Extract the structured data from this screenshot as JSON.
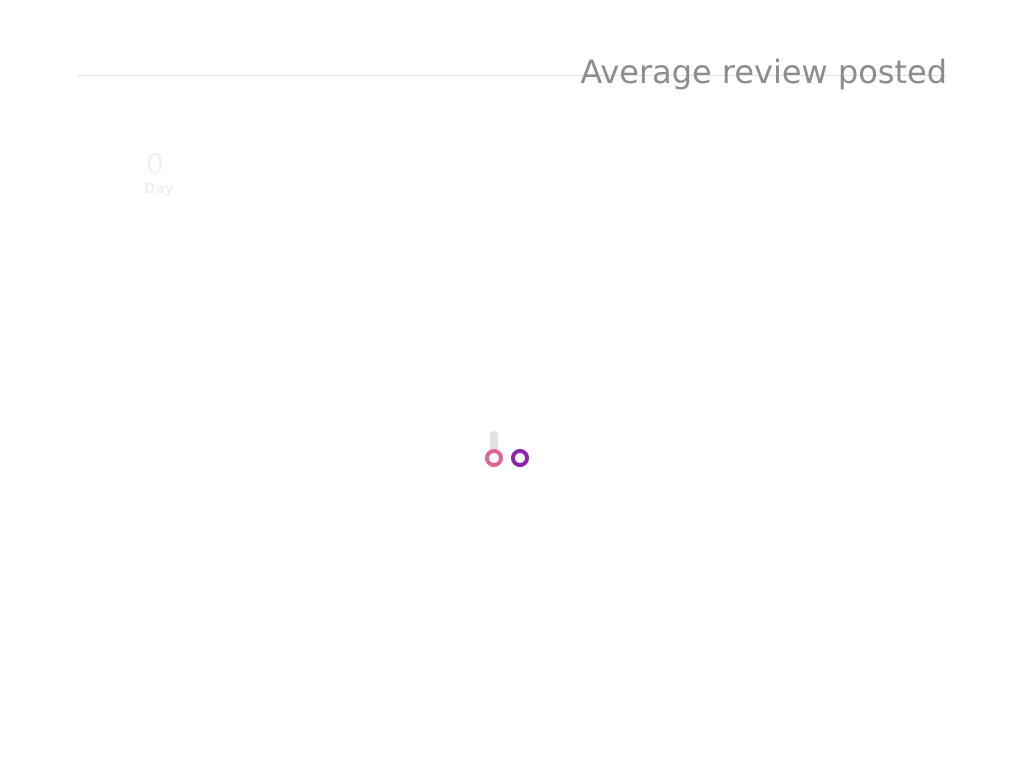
{
  "header": {
    "title": "Average review posted"
  },
  "stat": {
    "value": "0",
    "unit": "Day"
  },
  "loader": {
    "state": "loading",
    "colors": {
      "bar": "#e2e2e2",
      "dot_left": "#e0649a",
      "dot_right": "#8e24aa"
    }
  },
  "colors": {
    "title": "#8a8d92",
    "divider": "#e3e3e3",
    "background": "#ffffff"
  }
}
